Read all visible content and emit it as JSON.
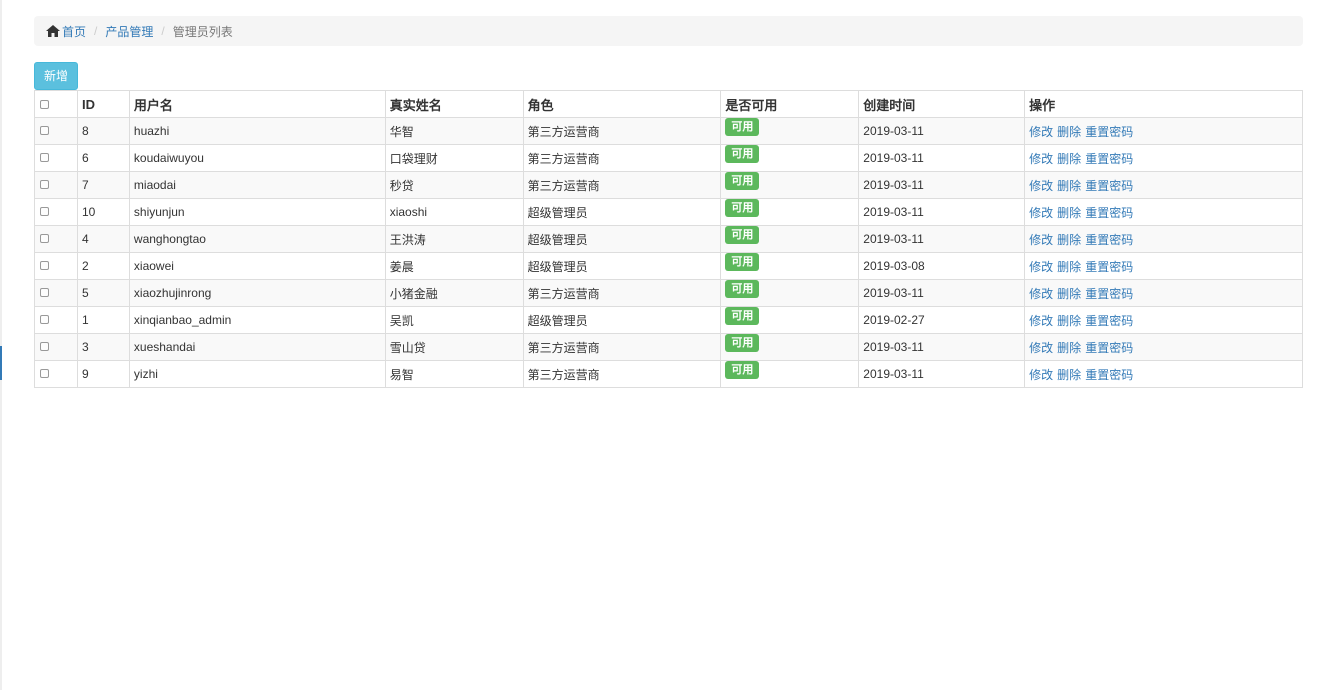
{
  "breadcrumb": {
    "home": "首页",
    "section": "产品管理",
    "current": "管理员列表"
  },
  "toolbar": {
    "add_label": "新增"
  },
  "table": {
    "headers": {
      "id": "ID",
      "username": "用户名",
      "realname": "真实姓名",
      "role": "角色",
      "enabled": "是否可用",
      "created": "创建时间",
      "actions": "操作"
    },
    "action_labels": {
      "edit": "修改",
      "delete": "删除",
      "reset": "重置密码"
    },
    "rows": [
      {
        "id": "8",
        "username": "huazhi",
        "realname": "华智",
        "role": "第三方运营商",
        "status": "可用",
        "created": "2019-03-11"
      },
      {
        "id": "6",
        "username": "koudaiwuyou",
        "realname": "口袋理财",
        "role": "第三方运营商",
        "status": "可用",
        "created": "2019-03-11"
      },
      {
        "id": "7",
        "username": "miaodai",
        "realname": "秒贷",
        "role": "第三方运营商",
        "status": "可用",
        "created": "2019-03-11"
      },
      {
        "id": "10",
        "username": "shiyunjun",
        "realname": "xiaoshi",
        "role": "超级管理员",
        "status": "可用",
        "created": "2019-03-11"
      },
      {
        "id": "4",
        "username": "wanghongtao",
        "realname": "王洪涛",
        "role": "超级管理员",
        "status": "可用",
        "created": "2019-03-11"
      },
      {
        "id": "2",
        "username": "xiaowei",
        "realname": "姜晨",
        "role": "超级管理员",
        "status": "可用",
        "created": "2019-03-08"
      },
      {
        "id": "5",
        "username": "xiaozhujinrong",
        "realname": "小猪金融",
        "role": "第三方运营商",
        "status": "可用",
        "created": "2019-03-11"
      },
      {
        "id": "1",
        "username": "xinqianbao_admin",
        "realname": "吴凯",
        "role": "超级管理员",
        "status": "可用",
        "created": "2019-02-27"
      },
      {
        "id": "3",
        "username": "xueshandai",
        "realname": "雪山贷",
        "role": "第三方运营商",
        "status": "可用",
        "created": "2019-03-11"
      },
      {
        "id": "9",
        "username": "yizhi",
        "realname": "易智",
        "role": "第三方运营商",
        "status": "可用",
        "created": "2019-03-11"
      }
    ]
  }
}
